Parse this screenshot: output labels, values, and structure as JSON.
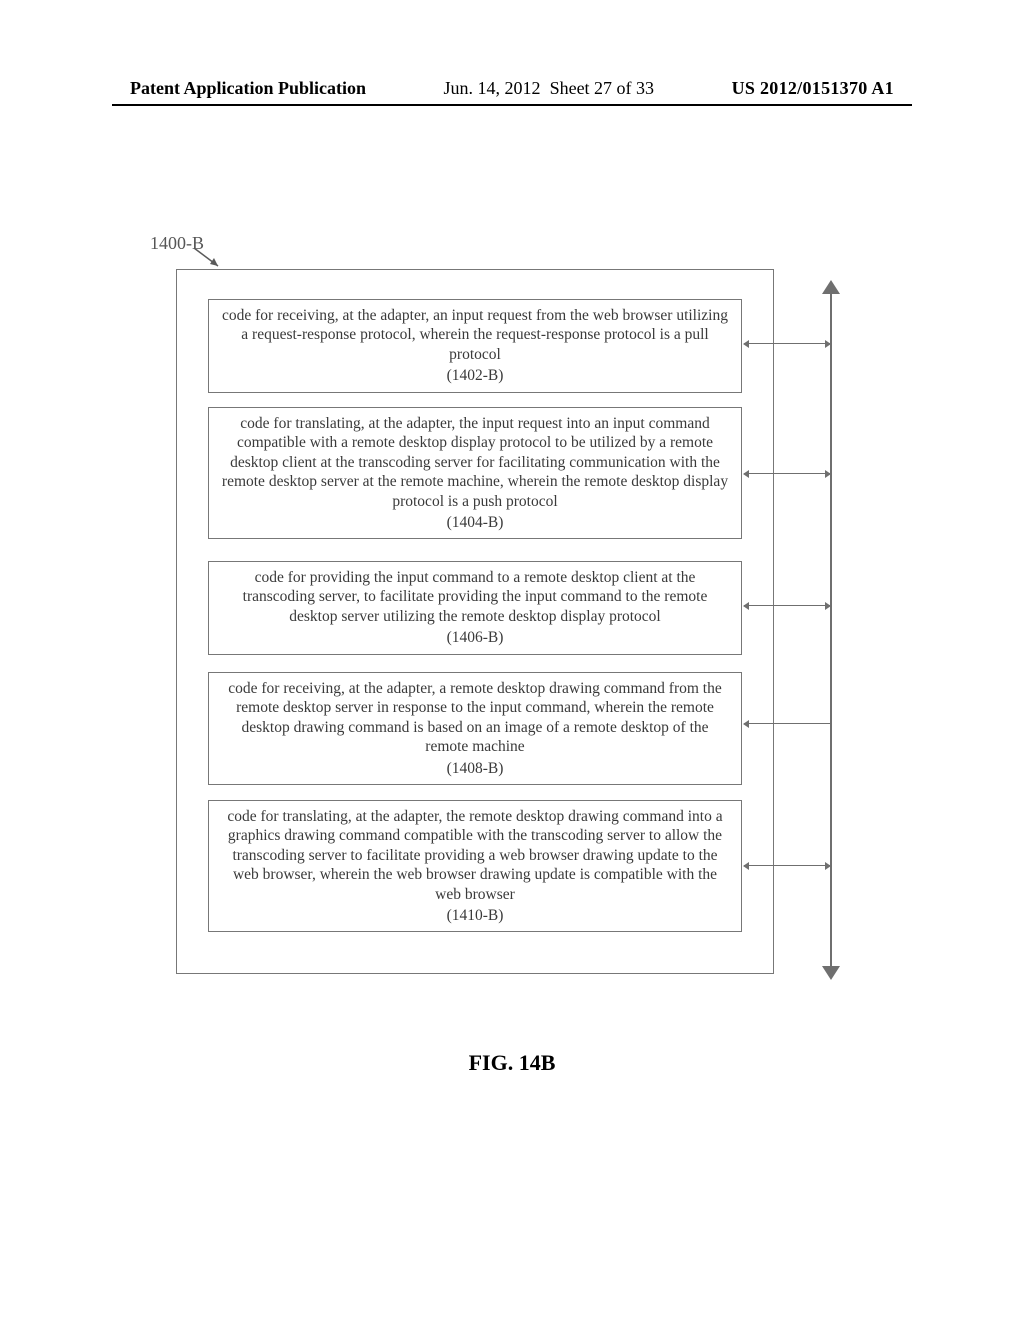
{
  "header": {
    "left": "Patent Application Publication",
    "date": "Jun. 14, 2012",
    "sheet": "Sheet 27 of 33",
    "pubno": "US 2012/0151370 A1"
  },
  "figure": {
    "ref_label": "1400-B",
    "caption": "FIG. 14B"
  },
  "steps": [
    {
      "text": "code for receiving, at the adapter, an input request from the web browser utilizing a request-response protocol, wherein the request-response protocol is a pull protocol",
      "ref": "(1402-B)"
    },
    {
      "text": "code for translating, at the adapter, the input request into an input command compatible with a remote desktop display protocol to be utilized by a remote desktop client at the transcoding server for facilitating communication with the remote desktop server at the remote machine, wherein the remote desktop display protocol is a push protocol",
      "ref": "(1404-B)"
    },
    {
      "text": "code for providing the input command to a remote desktop client at the transcoding server, to facilitate providing the input command to the remote desktop server utilizing the remote desktop display protocol",
      "ref": "(1406-B)"
    },
    {
      "text": "code for receiving, at the adapter, a remote desktop drawing command from the remote desktop server in response to the input command, wherein the remote desktop drawing command is based on an image of a remote desktop of the remote machine",
      "ref": "(1408-B)"
    },
    {
      "text": "code for translating, at the adapter, the remote desktop drawing command into a graphics drawing command compatible with the transcoding server to allow the transcoding server to facilitate providing a web browser drawing update to the web browser, wherein the web browser drawing update is compatible with the web browser",
      "ref": "(1410-B)"
    }
  ]
}
